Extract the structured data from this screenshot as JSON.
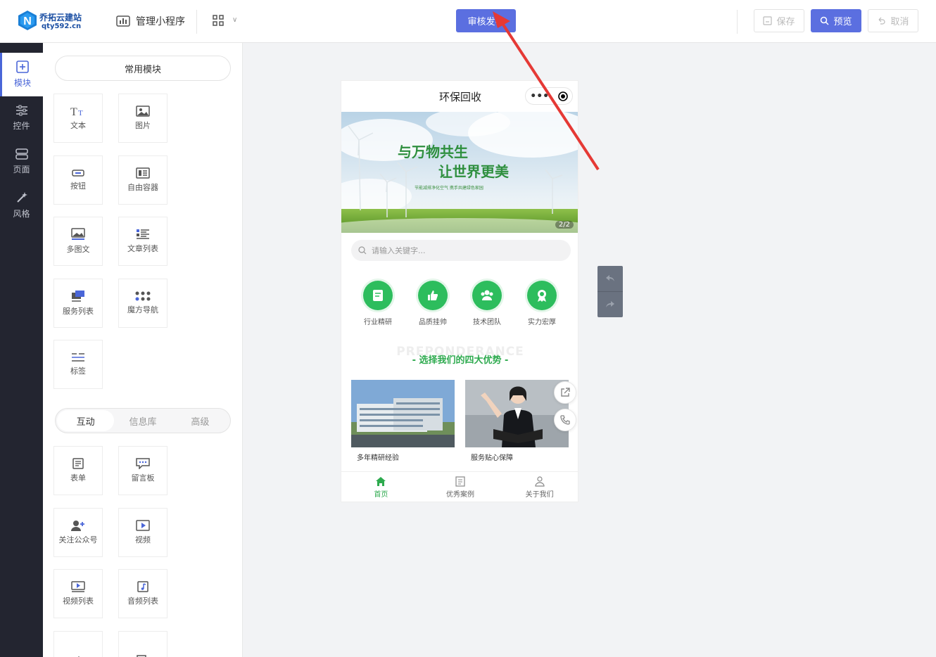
{
  "brand": {
    "name": "乔拓云建站",
    "domain": "qty592.cn"
  },
  "header": {
    "manage_label": "管理小程序",
    "publish_label": "审核发布",
    "save_label": "保存",
    "preview_label": "预览",
    "cancel_label": "取消"
  },
  "leftnav": [
    {
      "label": "模块",
      "icon": "plus-square-icon",
      "active": true
    },
    {
      "label": "控件",
      "icon": "sliders-icon",
      "active": false
    },
    {
      "label": "页面",
      "icon": "pages-icon",
      "active": false
    },
    {
      "label": "风格",
      "icon": "magic-wand-icon",
      "active": false
    }
  ],
  "panel": {
    "common_title": "常用模块",
    "modules": [
      "文本",
      "图片",
      "按钮",
      "自由容器",
      "多图文",
      "文章列表",
      "服务列表",
      "魔方导航",
      "标签"
    ],
    "tabs": [
      "互动",
      "信息库",
      "高级"
    ],
    "active_tab": "互动",
    "interact_modules": [
      "表单",
      "留言板",
      "关注公众号",
      "视频",
      "视频列表",
      "音频列表"
    ]
  },
  "phone": {
    "title": "环保回收",
    "capsule_dots": "•••",
    "banner": {
      "line1": "与万物共生",
      "line2": "让世界更美",
      "slogan": "节能减排净化空气  携手共建绿色家园",
      "counter": "2/2"
    },
    "search_placeholder": "请输入关键字...",
    "features": [
      "行业精研",
      "品质挂帅",
      "技术团队",
      "实力宏厚"
    ],
    "watermark": "PREPONDERANCE",
    "section_title": "- 选择我们的四大优势 -",
    "cards": [
      "多年精研经验",
      "服务贴心保障"
    ],
    "tabbar": [
      {
        "label": "首页",
        "active": true
      },
      {
        "label": "优秀案例",
        "active": false
      },
      {
        "label": "关于我们",
        "active": false
      }
    ]
  },
  "colors": {
    "accent": "#5b6fe0",
    "green": "#2daa4e",
    "sidebar": "#232530",
    "annotation": "#e53935"
  }
}
